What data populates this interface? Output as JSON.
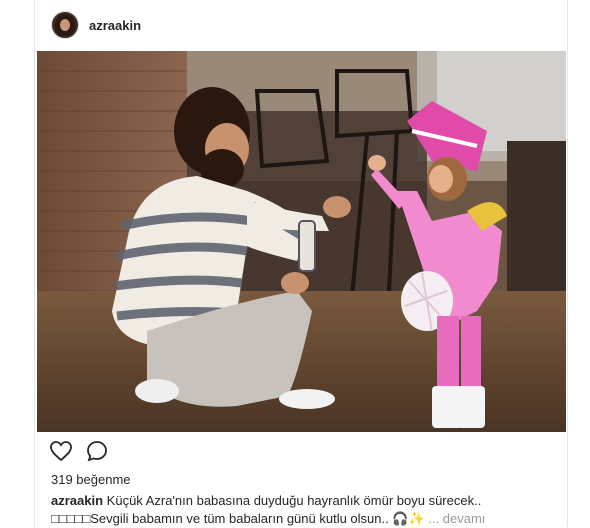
{
  "post": {
    "username": "azraakin",
    "likes": "319 beğenme",
    "caption_user": "azraakin",
    "caption_text": "Küçük Azra'nın babasına duyduğu hayranlık ömür boyu sürecek.. □□□□□Sevgili babamın ve tüm babaların günü kutlu olsun.. 🎧✨",
    "more_label": "... devamı"
  },
  "icons": {
    "avatar": "avatar-icon",
    "like": "heart-icon",
    "comment": "comment-icon"
  },
  "colors": {
    "text": "#262626",
    "muted": "#999999",
    "border": "#e6e6e6"
  }
}
